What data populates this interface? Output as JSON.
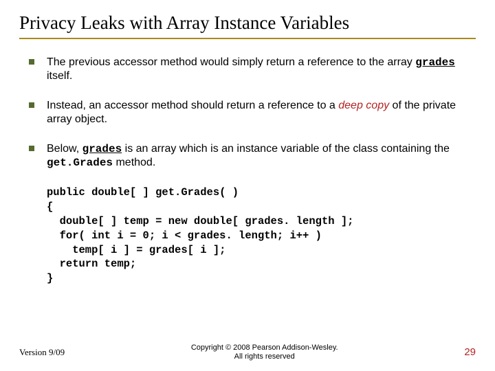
{
  "title": "Privacy Leaks with Array Instance Variables",
  "bullets": {
    "b1": {
      "pre": "The previous accessor method would simply return a reference to the array ",
      "code": "grades",
      "post": " itself."
    },
    "b2": {
      "pre": "Instead, an accessor method should return a reference to a ",
      "deep": "deep copy",
      "post": " of the private array object."
    },
    "b3": {
      "pre": "Below, ",
      "code1": "grades",
      "mid": " is an array which is an instance variable of the class containing the ",
      "code2": "get.Grades",
      "post": " method."
    }
  },
  "code": {
    "l1": "public double[ ] get.Grades( )",
    "l2": "{",
    "l3": "  double[ ] temp = new double[ grades. length ];",
    "l4": "  for( int i = 0; i < grades. length; i++ )",
    "l5": "    temp[ i ] = grades[ i ];",
    "l6": "  return temp;",
    "l7": "}"
  },
  "footer": {
    "version": "Version 9/09",
    "copy1": "Copyright © 2008 Pearson Addison-Wesley.",
    "copy2": "All rights reserved",
    "page": "29"
  }
}
